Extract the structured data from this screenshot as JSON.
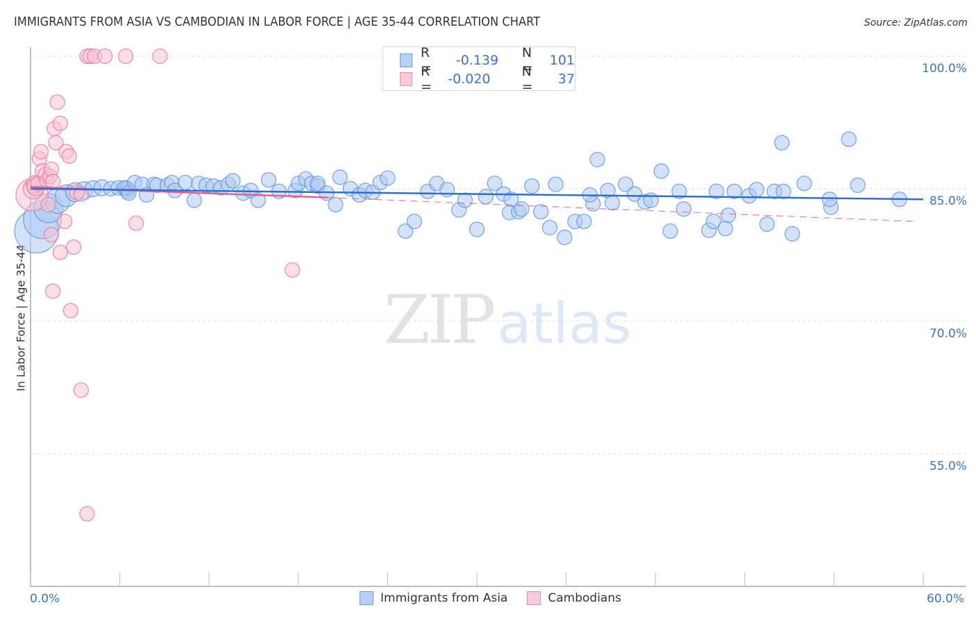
{
  "chart_data": {
    "type": "scatter",
    "title": "IMMIGRANTS FROM ASIA VS CAMBODIAN IN LABOR FORCE | AGE 35-44 CORRELATION CHART",
    "source": "Source: ZipAtlas.com",
    "xlabel": "",
    "ylabel": "In Labor Force | Age 35-44",
    "xlim": [
      0,
      60
    ],
    "ylim": [
      40,
      103
    ],
    "x_tick_labels": [
      "0.0%",
      "60.0%"
    ],
    "x_minor_ticks": [
      0,
      6,
      12,
      18,
      24,
      30,
      36,
      42,
      48,
      54,
      60
    ],
    "y_ticks": [
      100,
      85,
      70,
      55
    ],
    "y_tick_labels": [
      "100.0%",
      "85.0%",
      "70.0%",
      "55.0%"
    ],
    "grid": true,
    "legend": {
      "placement": "top-center",
      "entries": [
        {
          "r_label": "R =",
          "r_value": "-0.139",
          "n_label": "N =",
          "n_value": "101"
        },
        {
          "r_label": "R =",
          "r_value": "-0.020",
          "n_label": "N =",
          "n_value": "37"
        }
      ]
    },
    "watermark": {
      "part1": "ZIP",
      "part2": "atlas"
    },
    "series": [
      {
        "name": "Immigrants from Asia",
        "color": "#5b93e0",
        "fill": "#aecbf2",
        "trend": {
          "x": [
            0,
            60
          ],
          "y": [
            85.0,
            83.8
          ],
          "style": "solid"
        },
        "points": [
          [
            0.4,
            80.2,
            3
          ],
          [
            0.8,
            81.5,
            2.6
          ],
          [
            1.2,
            82.8,
            2
          ],
          [
            1.8,
            83.6,
            1.7
          ],
          [
            2.4,
            84.2,
            1.5
          ],
          [
            3.0,
            84.6,
            1.3
          ],
          [
            3.6,
            84.8,
            1.2
          ],
          [
            4.2,
            85.0,
            1.1
          ],
          [
            4.8,
            85.1,
            1.1
          ],
          [
            5.4,
            85.0,
            1
          ],
          [
            5.9,
            85.1,
            1
          ],
          [
            6.5,
            84.7,
            1
          ],
          [
            6.4,
            85.1,
            1
          ],
          [
            6.5,
            85.0,
            1
          ],
          [
            6.3,
            85.1,
            1
          ],
          [
            6.6,
            84.5,
            1
          ],
          [
            7.0,
            85.7,
            1
          ],
          [
            7.5,
            85.5,
            1
          ],
          [
            8.3,
            85.5,
            1
          ],
          [
            7.8,
            84.3,
            1
          ],
          [
            8.5,
            85.4,
            1
          ],
          [
            9.2,
            85.4,
            1
          ],
          [
            9.5,
            85.7,
            1
          ],
          [
            9.7,
            84.8,
            1
          ],
          [
            10.4,
            85.7,
            1
          ],
          [
            11.0,
            83.7,
            1
          ],
          [
            11.3,
            85.6,
            1
          ],
          [
            11.8,
            85.4,
            1
          ],
          [
            12.3,
            85.3,
            1
          ],
          [
            12.8,
            85.1,
            1
          ],
          [
            13.3,
            85.5,
            1
          ],
          [
            13.6,
            85.9,
            1
          ],
          [
            14.3,
            84.5,
            1
          ],
          [
            14.8,
            84.8,
            1
          ],
          [
            15.3,
            83.7,
            1
          ],
          [
            16.0,
            86.0,
            1
          ],
          [
            16.7,
            84.7,
            1
          ],
          [
            17.8,
            84.8,
            1
          ],
          [
            18.0,
            85.6,
            1
          ],
          [
            18.5,
            86.1,
            1
          ],
          [
            18.9,
            85.6,
            1
          ],
          [
            19.3,
            85.3,
            1
          ],
          [
            19.3,
            85.6,
            1
          ],
          [
            19.9,
            84.5,
            1
          ],
          [
            20.5,
            83.2,
            1
          ],
          [
            20.8,
            86.3,
            1
          ],
          [
            21.5,
            85.0,
            1
          ],
          [
            22.1,
            84.3,
            1
          ],
          [
            22.5,
            84.8,
            1
          ],
          [
            23.0,
            84.6,
            1
          ],
          [
            23.5,
            85.7,
            1
          ],
          [
            24.0,
            86.2,
            1
          ],
          [
            25.2,
            80.2,
            1
          ],
          [
            25.8,
            81.3,
            1
          ],
          [
            26.7,
            84.7,
            1
          ],
          [
            27.3,
            85.6,
            1
          ],
          [
            28.0,
            84.9,
            1
          ],
          [
            28.8,
            82.6,
            1
          ],
          [
            29.2,
            83.7,
            1
          ],
          [
            30.0,
            80.4,
            1
          ],
          [
            30.6,
            84.1,
            1
          ],
          [
            31.2,
            85.6,
            1
          ],
          [
            31.8,
            84.4,
            1
          ],
          [
            32.3,
            83.8,
            1
          ],
          [
            32.2,
            82.3,
            1
          ],
          [
            32.8,
            82.4,
            1
          ],
          [
            33.0,
            82.7,
            1
          ],
          [
            33.7,
            85.3,
            1
          ],
          [
            34.3,
            82.4,
            1
          ],
          [
            34.9,
            80.6,
            1
          ],
          [
            35.3,
            85.5,
            1
          ],
          [
            35.9,
            79.5,
            1
          ],
          [
            36.6,
            81.3,
            1
          ],
          [
            37.2,
            81.3,
            1
          ],
          [
            37.8,
            83.3,
            1
          ],
          [
            37.6,
            84.3,
            1
          ],
          [
            38.1,
            88.3,
            1
          ],
          [
            38.8,
            84.8,
            1
          ],
          [
            39.1,
            83.4,
            1
          ],
          [
            40.0,
            85.5,
            1
          ],
          [
            40.6,
            84.4,
            1
          ],
          [
            41.3,
            83.5,
            1
          ],
          [
            41.7,
            83.7,
            1
          ],
          [
            42.4,
            87.0,
            1
          ],
          [
            43.0,
            80.2,
            1
          ],
          [
            43.6,
            84.7,
            1
          ],
          [
            43.9,
            82.7,
            1
          ],
          [
            45.6,
            80.3,
            1
          ],
          [
            45.9,
            81.3,
            1
          ],
          [
            46.1,
            84.7,
            1
          ],
          [
            46.7,
            80.5,
            1
          ],
          [
            46.9,
            82.0,
            1
          ],
          [
            47.3,
            84.7,
            1
          ],
          [
            48.3,
            84.2,
            1
          ],
          [
            48.8,
            84.9,
            1
          ],
          [
            49.5,
            81.0,
            1
          ],
          [
            50.0,
            84.7,
            1
          ],
          [
            50.5,
            90.2,
            1
          ],
          [
            50.6,
            84.7,
            1
          ],
          [
            51.2,
            79.9,
            1
          ],
          [
            52.0,
            85.6,
            1
          ],
          [
            53.8,
            82.9,
            1
          ],
          [
            53.7,
            83.8,
            1
          ],
          [
            55.0,
            90.6,
            1
          ],
          [
            55.6,
            85.4,
            1
          ],
          [
            58.4,
            83.8,
            1
          ]
        ]
      },
      {
        "name": "Cambodians",
        "color": "#e8799a",
        "fill": "#f8c2d2",
        "trend": {
          "x": [
            0,
            20
          ],
          "y": [
            85.2,
            84.0
          ],
          "style": "solid",
          "extended_to": 60,
          "extended_y": 81.3,
          "extended_style": "dashed"
        },
        "points": [
          [
            0.1,
            84.3,
            2.2
          ],
          [
            0.2,
            85.0,
            1.4
          ],
          [
            0.3,
            85.5,
            1.2
          ],
          [
            0.35,
            85.2,
            1.2
          ],
          [
            0.5,
            85.6,
            1
          ],
          [
            0.6,
            88.4,
            1
          ],
          [
            0.7,
            89.2,
            1
          ],
          [
            0.8,
            87.0,
            1
          ],
          [
            1.0,
            86.6,
            1
          ],
          [
            1.1,
            85.9,
            1
          ],
          [
            1.2,
            83.2,
            1
          ],
          [
            1.3,
            86.4,
            1
          ],
          [
            1.4,
            87.2,
            1
          ],
          [
            1.5,
            85.8,
            1
          ],
          [
            1.4,
            79.8,
            1
          ],
          [
            1.5,
            73.4,
            1
          ],
          [
            1.6,
            91.8,
            1
          ],
          [
            1.7,
            90.2,
            1
          ],
          [
            1.8,
            94.8,
            1
          ],
          [
            2.0,
            92.4,
            1
          ],
          [
            2.0,
            77.8,
            1
          ],
          [
            2.3,
            81.3,
            1
          ],
          [
            2.4,
            89.2,
            1
          ],
          [
            2.6,
            88.7,
            1
          ],
          [
            2.7,
            71.2,
            1
          ],
          [
            2.9,
            78.4,
            1
          ],
          [
            3.1,
            84.6,
            1
          ],
          [
            3.4,
            84.4,
            1
          ],
          [
            3.4,
            62.2,
            1
          ],
          [
            3.8,
            48.2,
            1
          ],
          [
            3.8,
            100.0,
            1
          ],
          [
            4.0,
            100.0,
            1
          ],
          [
            4.3,
            100.0,
            1
          ],
          [
            5.0,
            100.0,
            1
          ],
          [
            6.4,
            100.0,
            1
          ],
          [
            7.1,
            81.1,
            1
          ],
          [
            8.7,
            100.0,
            1
          ],
          [
            17.6,
            75.8,
            1
          ]
        ]
      }
    ]
  },
  "bottom_legend": {
    "items": [
      {
        "label": "Immigrants from Asia"
      },
      {
        "label": "Cambodians"
      }
    ]
  },
  "colors": {
    "blue_stroke": "#5b93e0",
    "blue_fill": "#aecbf2",
    "blue_line": "#2a6fd6",
    "pink_stroke": "#e8799a",
    "pink_fill": "#f8c2d2",
    "pink_line": "#e0608a",
    "tick_text": "#3c73c9"
  }
}
